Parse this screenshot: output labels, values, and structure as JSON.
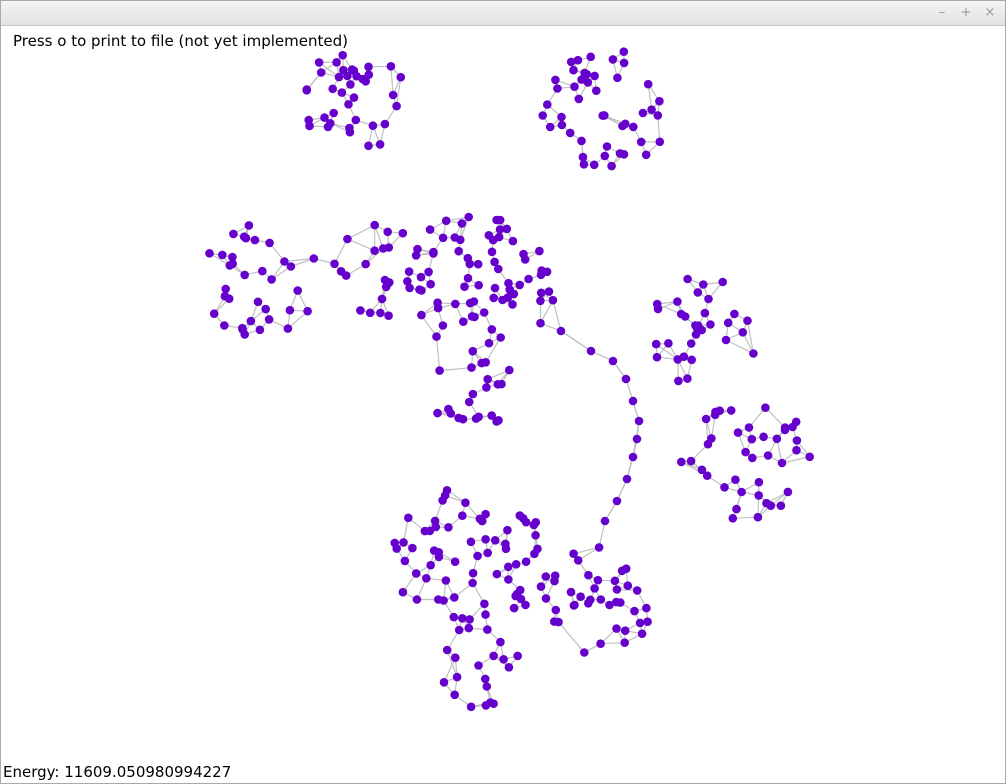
{
  "window": {
    "controls": {
      "minimize_glyph": "–",
      "maximize_glyph": "+",
      "close_glyph": "×"
    }
  },
  "canvas": {
    "hint": "Press o to print to file (not yet implemented)",
    "energy": "Energy: 11609.050980994227",
    "node_color": "#6600cc",
    "edge_color": "#c0c0c0",
    "background": "#ffffff"
  }
}
